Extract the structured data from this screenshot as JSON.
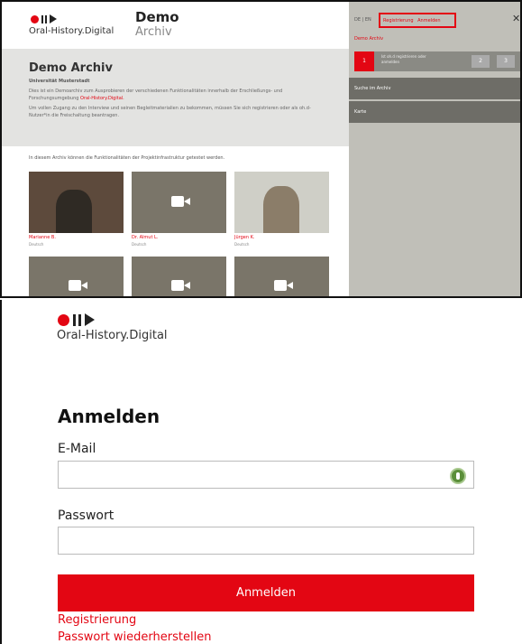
{
  "top_panel": {
    "brand": "Oral-History.Digital",
    "header_title": "Demo",
    "header_subtitle": "Archiv",
    "intro": {
      "title": "Demo Archiv",
      "institution": "Universität Musterstadt",
      "text1": "Dies ist ein Demoarchiv zum Ausprobieren der verschiedenen Funktionalitäten innerhalb der Erschließungs- und Forschungsumgebung",
      "link": "Oral-History.Digital.",
      "text2": "Um vollen Zugang zu den Interview und seinen Begleitmaterialien zu bekommen, müssen Sie sich registrieren oder als oh.d-Nutzer*in die Freischaltung beantragen."
    },
    "note": "In diesem Archiv können die Funktionalitäten der Projektinfrastruktur getestet werden.",
    "people": [
      {
        "name": "Marianne B.",
        "lang": "Deutsch"
      },
      {
        "name": "Dr. Almut L.",
        "lang": "Deutsch"
      },
      {
        "name": "Jürgen K.",
        "lang": "Deutsch"
      }
    ],
    "sidebar": {
      "lang": "DE | EN",
      "register": "Registrierung",
      "login": "Anmelden",
      "title": "Demo Archiv",
      "step1": "1",
      "step_text": "Ist oh.d registrieren oder anmelden",
      "step2": "2",
      "step3": "3",
      "menu1": "Suche im Archiv",
      "menu2": "Karte"
    }
  },
  "login": {
    "heading": "Anmelden",
    "email_label": "E-Mail",
    "email_value": "",
    "password_label": "Passwort",
    "password_value": "",
    "submit": "Anmelden",
    "register_link": "Registrierung",
    "forgot_link": "Passwort wiederherstellen"
  },
  "colors": {
    "accent": "#e30613",
    "sidebar": "#c0bfb8",
    "menu": "#6e6d67"
  },
  "icons": [
    "record-icon",
    "pause-icon",
    "play-icon",
    "video-camera-icon",
    "close-icon",
    "password-manager-icon"
  ]
}
